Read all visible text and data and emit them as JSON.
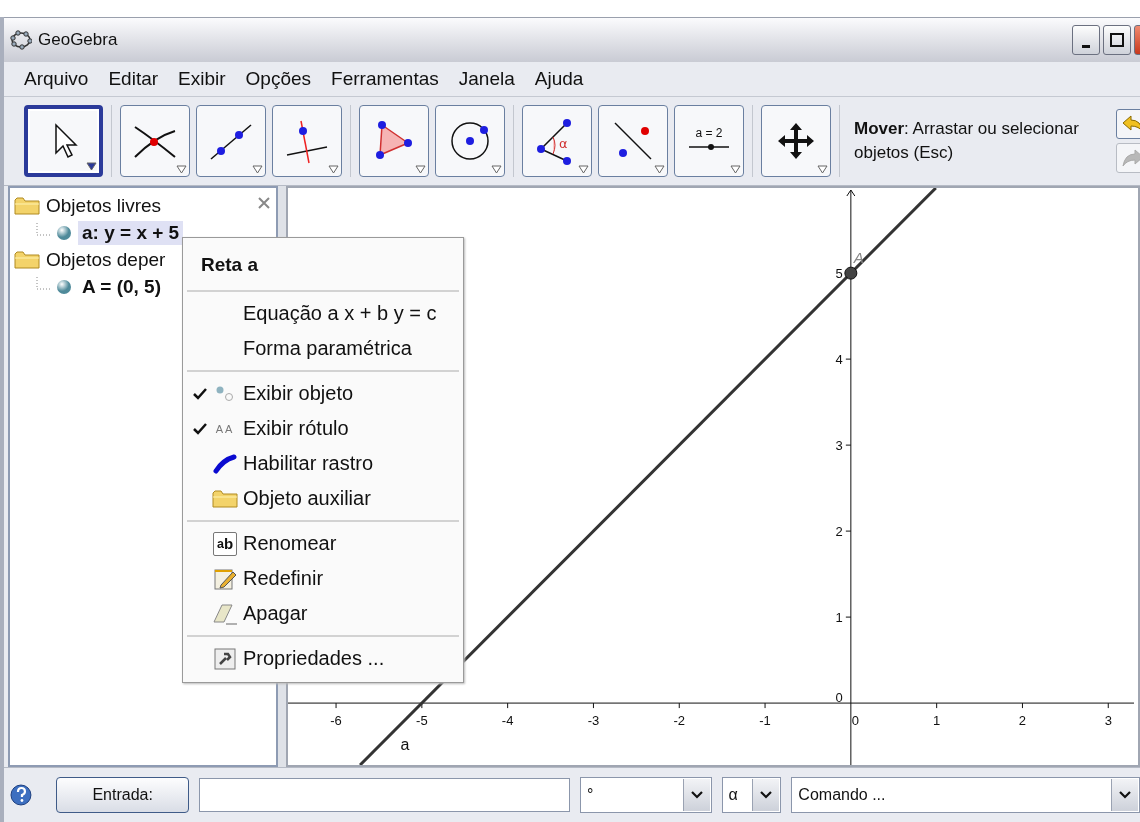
{
  "window": {
    "title": "GeoGebra"
  },
  "menu_bar": [
    "Arquivo",
    "Editar",
    "Exibir",
    "Opções",
    "Ferramentas",
    "Janela",
    "Ajuda"
  ],
  "toolbar": {
    "groups": [
      [
        {
          "kind": "move",
          "selected": true
        }
      ],
      [
        {
          "kind": "intersect",
          "selected": false
        },
        {
          "kind": "line",
          "selected": false
        },
        {
          "kind": "perpendicular",
          "selected": false
        }
      ],
      [
        {
          "kind": "polygon",
          "selected": false
        },
        {
          "kind": "circle",
          "selected": false
        }
      ],
      [
        {
          "kind": "angle",
          "selected": false,
          "caption": "α"
        },
        {
          "kind": "reflect",
          "selected": false
        },
        {
          "kind": "slider",
          "selected": false,
          "caption": "a = 2"
        }
      ],
      [
        {
          "kind": "pan",
          "selected": false
        }
      ]
    ],
    "help": "**Mover**: Arrastar ou selecionar objetos (Esc)",
    "undo": {
      "disabled": false
    },
    "redo": {
      "disabled": true
    }
  },
  "algebra_tree": [
    {
      "label": "Objetos livres",
      "children": [
        {
          "label": "a: y = x + 5",
          "selected": true
        }
      ]
    },
    {
      "label": "Objetos deper",
      "children": [
        {
          "label": "A = (0, 5)",
          "selected": false
        }
      ]
    }
  ],
  "graphics": {
    "chart_data": {
      "type": "line",
      "x": [
        -5.72,
        0.99
      ],
      "series": [
        {
          "name": "a",
          "color": "#333333",
          "values": [
            -0.72,
            5.99
          ]
        }
      ],
      "xlim": [
        -6.56,
        3.3
      ],
      "ylim": [
        -0.72,
        5.99
      ],
      "xticks": [
        -6,
        -5,
        -4,
        -3,
        -2,
        -1,
        0,
        1,
        2,
        3
      ],
      "yticks": [
        0,
        1,
        2,
        3,
        4,
        5
      ],
      "annotations": [
        {
          "text": "A",
          "x": 0,
          "y": 5
        }
      ]
    }
  },
  "context_menu": {
    "title": "Reta a",
    "sections": [
      [
        {
          "label": "Equação a x + b y = c",
          "kind": "text"
        },
        {
          "label": "Forma paramétrica",
          "kind": "text"
        }
      ],
      [
        {
          "label": "Exibir objeto",
          "kind": "visibility",
          "checked": true
        },
        {
          "label": "Exibir rótulo",
          "kind": "caption",
          "checked": true,
          "glyph": "AA"
        },
        {
          "label": "Habilitar rastro",
          "kind": "trace",
          "checked": false
        },
        {
          "label": "Objeto auxiliar",
          "kind": "auxiliary",
          "checked": false
        }
      ],
      [
        {
          "label": "Renomear",
          "kind": "rename",
          "glyph": "$^{a}$b"
        },
        {
          "label": "Redefinir",
          "kind": "redefine"
        },
        {
          "label": "Apagar",
          "kind": "delete"
        }
      ],
      [
        {
          "label": "Propriedades ...",
          "kind": "properties"
        }
      ]
    ]
  },
  "input_bar": {
    "button": "Entrada:",
    "degree_dropdown": "°",
    "greek_dropdown": "α",
    "command_dropdown": "Comando ..."
  }
}
